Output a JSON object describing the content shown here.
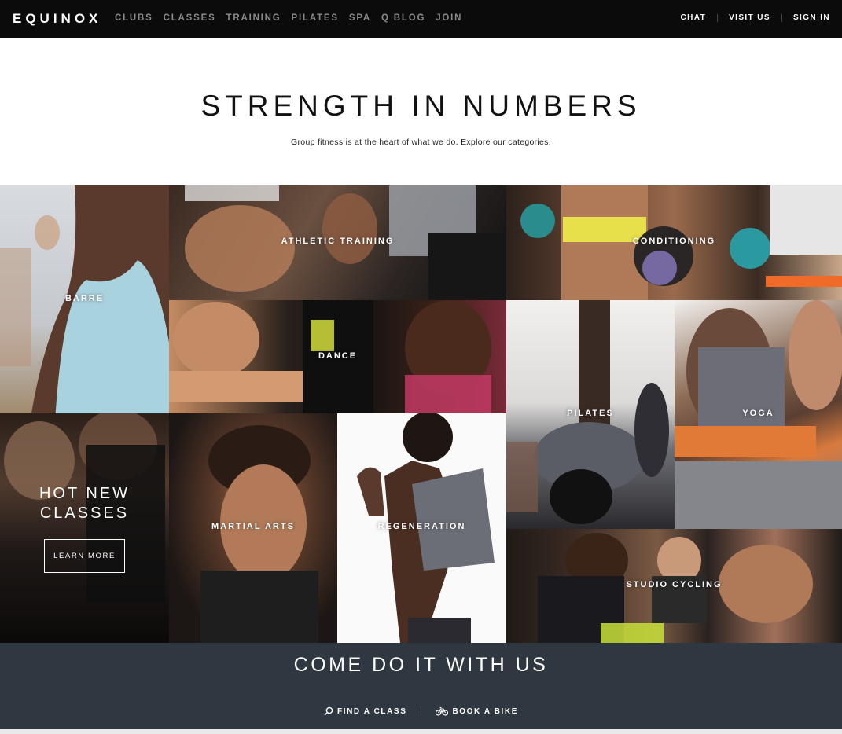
{
  "nav": {
    "logo": "EQUINOX",
    "links": [
      "CLUBS",
      "CLASSES",
      "TRAINING",
      "PILATES",
      "SPA",
      "Q BLOG",
      "JOIN"
    ],
    "right": [
      "CHAT",
      "VISIT US",
      "SIGN IN"
    ]
  },
  "hero": {
    "title": "STRENGTH IN NUMBERS",
    "subtitle": "Group fitness is at the heart of what we do. Explore our categories."
  },
  "tiles": {
    "barre": "BARRE",
    "athletic": "ATHLETIC TRAINING",
    "conditioning": "CONDITIONING",
    "dance": "DANCE",
    "pilates": "PILATES",
    "yoga": "YOGA",
    "martial": "MARTIAL ARTS",
    "regeneration": "REGENERATION",
    "cycling": "STUDIO CYCLING"
  },
  "promo": {
    "title_line1": "HOT NEW",
    "title_line2": "CLASSES",
    "button": "LEARN MORE"
  },
  "band": {
    "title": "COME DO IT WITH US",
    "find_class": "FIND A CLASS",
    "book_bike": "BOOK A BIKE"
  },
  "icons": {
    "find_class": "search-icon",
    "book_bike": "bike-icon"
  },
  "colors": {
    "nav_bg": "#0b0b0b",
    "band_bg": "#2f3741",
    "nav_link": "#8a8a8a"
  }
}
